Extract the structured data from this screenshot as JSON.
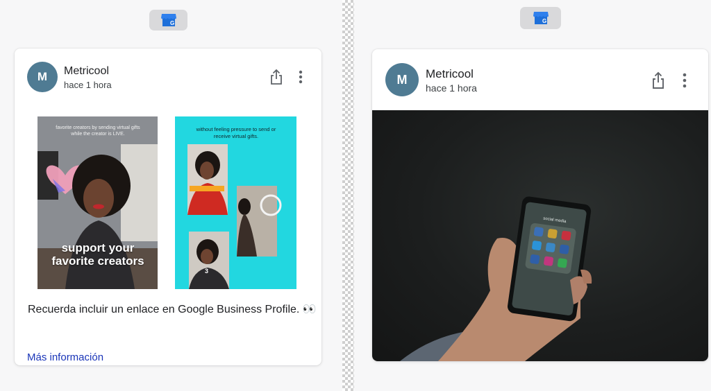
{
  "left_post": {
    "author": "Metricool",
    "avatar_letter": "M",
    "time": "hace 1 hora",
    "tile1_top_text": "favorite creators by sending virtual gifts while the creator is LIVE.",
    "tile1_headline": "support your favorite creators",
    "tile2_top_text": "without feeling pressure to send or receive virtual gifts.",
    "tile2_badge": "3",
    "caption": "Recuerda incluir un enlace en Google Business Profile. 👀",
    "more_link": "Más información"
  },
  "right_post": {
    "author": "Metricool",
    "avatar_letter": "M",
    "time": "hace 1 hora",
    "phone_screen_title": "social media"
  },
  "colors": {
    "avatar": "#4f7b93",
    "link": "#1a35b8",
    "gbp_blue": "#2f80ed",
    "tile2_bg": "#22d7e0"
  },
  "icons": [
    "google-business-profile-icon",
    "share-icon",
    "more-vert-icon"
  ]
}
